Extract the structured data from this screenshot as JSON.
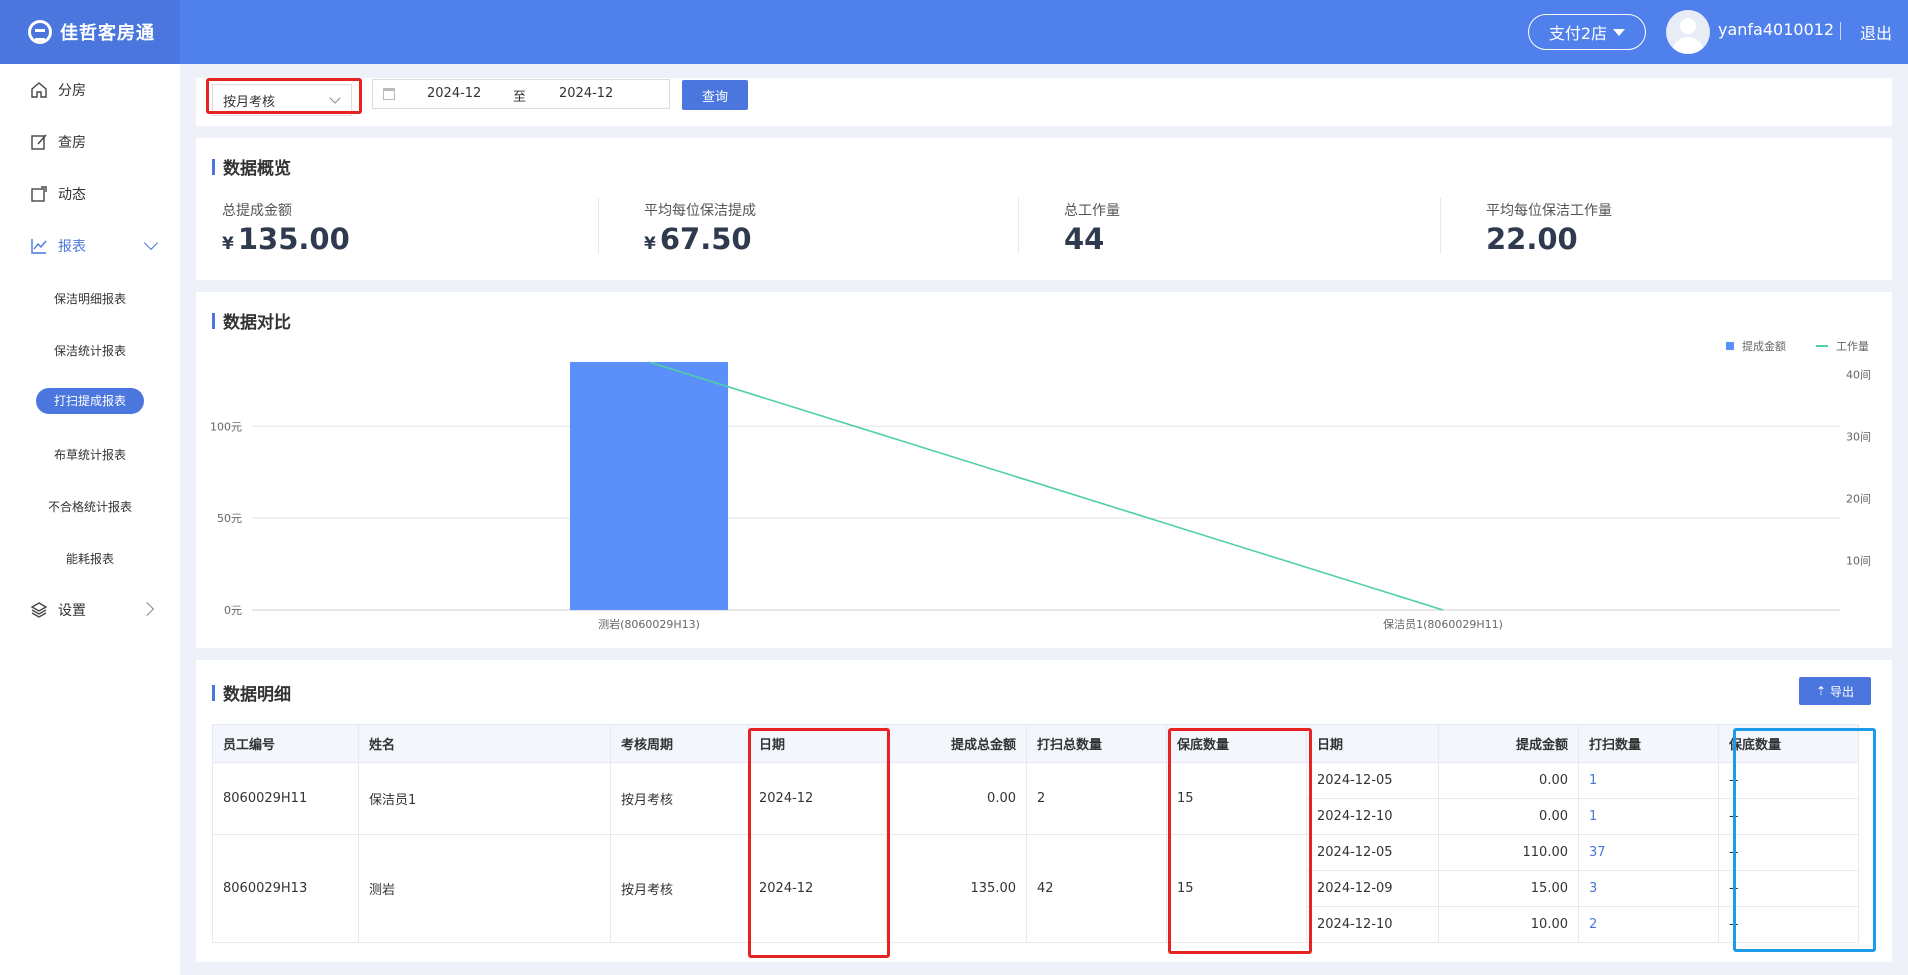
{
  "header": {
    "brand": "佳哲客房通",
    "store": "支付2店",
    "username": "yanfa4010012",
    "logout": "退出"
  },
  "sidebar": {
    "items": [
      {
        "label": "分房",
        "icon": "home-icon"
      },
      {
        "label": "查房",
        "icon": "edit-icon"
      },
      {
        "label": "动态",
        "icon": "share-icon"
      },
      {
        "label": "报表",
        "icon": "chart-icon"
      },
      {
        "label": "设置",
        "icon": "layers-icon"
      }
    ],
    "sub_items": [
      "保洁明细报表",
      "保洁统计报表",
      "打扫提成报表",
      "布草统计报表",
      "不合格统计报表",
      "能耗报表"
    ]
  },
  "filter": {
    "mode": "按月考核",
    "start": "2024-12",
    "separator": "至",
    "end": "2024-12",
    "query": "查询"
  },
  "overview": {
    "title": "数据概览",
    "currency": "¥",
    "stats": [
      {
        "label": "总提成金额",
        "value": "135.00"
      },
      {
        "label": "平均每位保洁提成",
        "value": "67.50"
      },
      {
        "label": "总工作量",
        "value": "44"
      },
      {
        "label": "平均每位保洁工作量",
        "value": "22.00"
      }
    ]
  },
  "compare": {
    "title": "数据对比"
  },
  "chart_data": {
    "type": "bar",
    "categories": [
      "测岩(8060029H13)",
      "保洁员1(8060029H11)"
    ],
    "series": [
      {
        "name": "提成金额",
        "type": "bar",
        "axis": "left",
        "values": [
          135,
          0
        ]
      },
      {
        "name": "工作量",
        "type": "line",
        "axis": "right",
        "values": [
          42,
          2
        ]
      }
    ],
    "left_axis": {
      "ticks": [
        "0元",
        "50元",
        "100元"
      ],
      "ylim": [
        0,
        135
      ]
    },
    "right_axis": {
      "ticks": [
        "10间",
        "20间",
        "30间",
        "40间"
      ],
      "ylim": [
        2,
        42
      ]
    },
    "legend_position": "top-right",
    "colors": {
      "bar": "#5b8ff9",
      "line": "#4fd0a7"
    },
    "grid": true
  },
  "detail": {
    "title": "数据明细",
    "export": "导出",
    "columns": [
      "员工编号",
      "姓名",
      "考核周期",
      "日期",
      "提成总金额",
      "打扫总数量",
      "保底数量",
      "日期",
      "提成金额",
      "打扫数量",
      "保底数量"
    ],
    "rows": [
      {
        "emp_id": "8060029H11",
        "name": "保洁员1",
        "period": "按月考核",
        "date": "2024-12",
        "total_amount": "0.00",
        "total_count": "2",
        "min_count": "15",
        "days": [
          {
            "date": "2024-12-05",
            "amount": "0.00",
            "count": "1",
            "min": "--"
          },
          {
            "date": "2024-12-10",
            "amount": "0.00",
            "count": "1",
            "min": "--"
          }
        ]
      },
      {
        "emp_id": "8060029H13",
        "name": "测岩",
        "period": "按月考核",
        "date": "2024-12",
        "total_amount": "135.00",
        "total_count": "42",
        "min_count": "15",
        "days": [
          {
            "date": "2024-12-05",
            "amount": "110.00",
            "count": "37",
            "min": "--"
          },
          {
            "date": "2024-12-09",
            "amount": "15.00",
            "count": "3",
            "min": "--"
          },
          {
            "date": "2024-12-10",
            "amount": "10.00",
            "count": "2",
            "min": "--"
          }
        ]
      }
    ]
  }
}
